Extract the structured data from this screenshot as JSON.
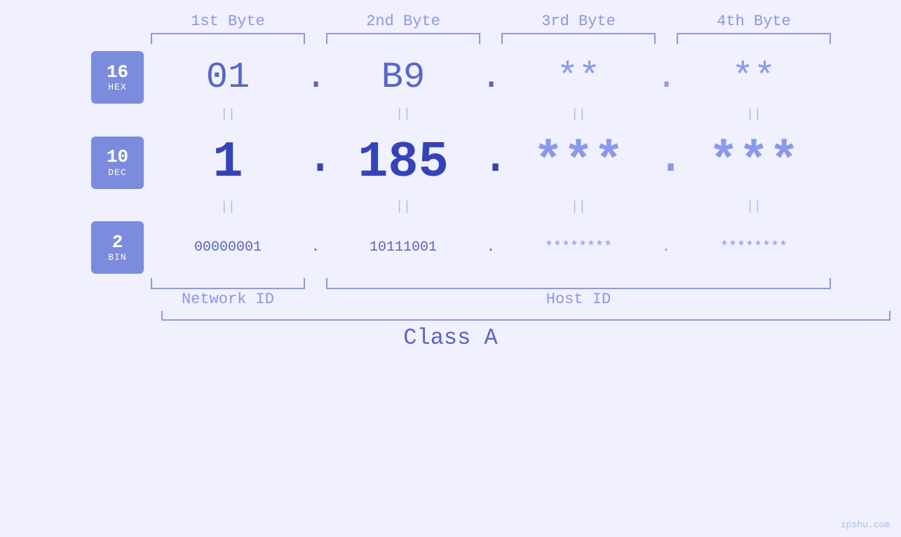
{
  "header": {
    "byte1_label": "1st Byte",
    "byte2_label": "2nd Byte",
    "byte3_label": "3rd Byte",
    "byte4_label": "4th Byte"
  },
  "badges": {
    "hex": {
      "number": "16",
      "text": "HEX"
    },
    "dec": {
      "number": "10",
      "text": "DEC"
    },
    "bin": {
      "number": "2",
      "text": "BIN"
    }
  },
  "hex_row": {
    "byte1": "01",
    "byte2": "B9",
    "byte3": "**",
    "byte4": "**"
  },
  "dec_row": {
    "byte1": "1",
    "byte2": "185",
    "byte3": "***",
    "byte4": "***"
  },
  "bin_row": {
    "byte1": "00000001",
    "byte2": "10111001",
    "byte3": "********",
    "byte4": "********"
  },
  "labels": {
    "network_id": "Network ID",
    "host_id": "Host ID",
    "class": "Class A"
  },
  "watermark": "ipshu.com",
  "colors": {
    "badge_bg": "#7b8cde",
    "value_color": "#5566cc",
    "masked_color": "#8899ee",
    "bracket_color": "#8899ee",
    "bg_color": "#f0f0ff"
  }
}
